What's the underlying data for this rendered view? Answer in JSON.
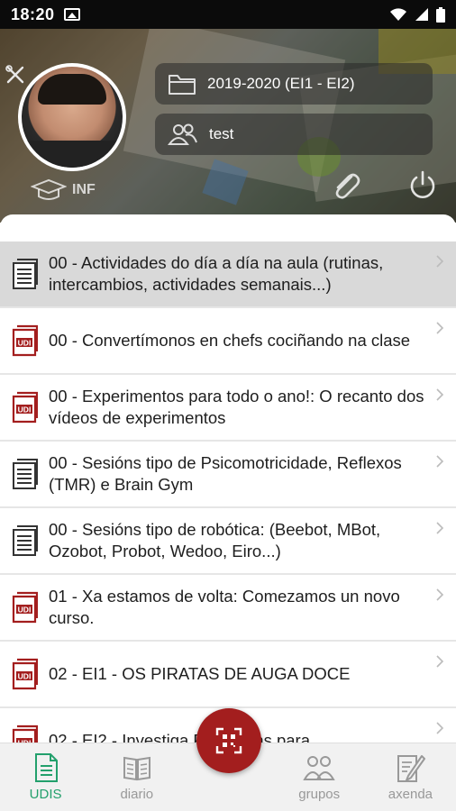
{
  "status_bar": {
    "time": "18:20",
    "icons": [
      "image-icon",
      "wifi-icon",
      "signal-icon",
      "battery-icon"
    ]
  },
  "header": {
    "role": "INF",
    "school_year": "2019-2020 (EI1 - EI2)",
    "group": "test",
    "icons": [
      "tools-icon",
      "graduation-cap-icon",
      "folder-icon",
      "group-icon",
      "paperclip-icon",
      "power-icon"
    ]
  },
  "list": {
    "items": [
      {
        "title": "00 - Actividades do día a día na aula (rutinas, intercambios, actividades semanais...)",
        "icon": "doc-gray",
        "selected": true
      },
      {
        "title": "00 - Convertímonos en chefs cociñando na clase",
        "icon": "udi-red",
        "selected": false
      },
      {
        "title": "00 - Experimentos para todo o ano!: O recanto dos vídeos de experimentos",
        "icon": "udi-red",
        "selected": false
      },
      {
        "title": "00 - Sesións tipo de Psicomotricidade, Reflexos (TMR) e Brain Gym",
        "icon": "doc-gray",
        "selected": false
      },
      {
        "title": "00 - Sesións tipo de robótica: (Beebot, MBot, Ozobot, Probot, Wedoo, Eiro...)",
        "icon": "doc-gray",
        "selected": false
      },
      {
        "title": "01 - Xa estamos de volta: Comezamos un novo curso.",
        "icon": "udi-red",
        "selected": false
      },
      {
        "title": "02 - EI1 - OS PIRATAS DE AUGA DOCE",
        "icon": "udi-red",
        "selected": false
      },
      {
        "title": "02 - EI2 - Investiga Pokemons para",
        "icon": "udi-red",
        "selected": false
      }
    ]
  },
  "tabs": [
    {
      "label": "UDIS",
      "icon": "udis-doc-icon",
      "active": true
    },
    {
      "label": "diario",
      "icon": "diary-icon",
      "active": false
    },
    {
      "label": "",
      "icon": "",
      "active": false
    },
    {
      "label": "grupos",
      "icon": "groups-icon",
      "active": false
    },
    {
      "label": "axenda",
      "icon": "agenda-icon",
      "active": false
    }
  ],
  "fab": {
    "icon": "qr-scan-icon"
  },
  "colors": {
    "accent_green": "#23a06c",
    "udi_red": "#a31e1e",
    "selected_row": "#d9d9d9"
  }
}
